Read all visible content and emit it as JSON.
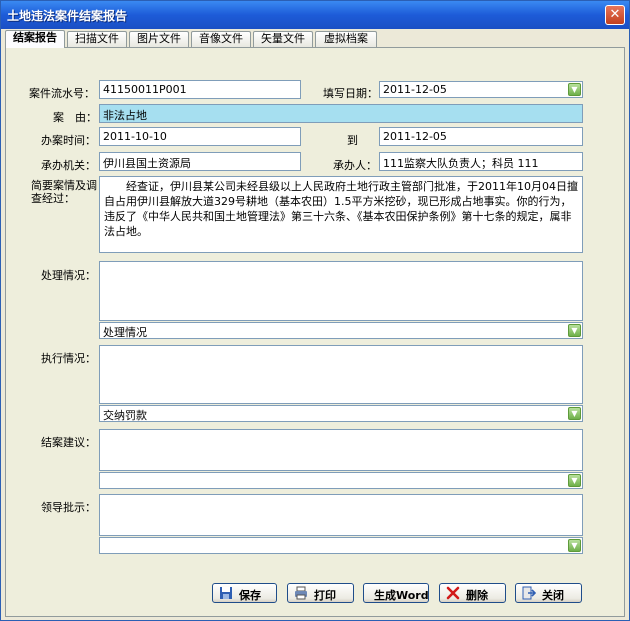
{
  "window": {
    "title": "土地违法案件结案报告",
    "close_symbol": "✕"
  },
  "tabs": [
    "结案报告",
    "扫描文件",
    "图片文件",
    "音像文件",
    "矢量文件",
    "虚拟档案"
  ],
  "form": {
    "case_no_label": "案件流水号：",
    "case_no": "41150011P001",
    "fill_date_label": "填写日期：",
    "fill_date": "2011-12-05",
    "cause_label": "案　由：",
    "cause": "非法占地",
    "handle_time_label": "办案时间：",
    "handle_start": "2011-10-10",
    "to_label": "到",
    "handle_end": "2011-12-05",
    "agency_label": "承办机关：",
    "agency": "伊川县国土资源局",
    "handler_label": "承办人：",
    "handler": "111监察大队负责人；科员 111",
    "summary_label": "简要案情及调查经过：",
    "summary": "　　经查证，伊川县某公司未经县级以上人民政府土地行政主管部门批准，于2011年10月04日擅自占用伊川县解放大道329号耕地（基本农田）1.5平方米挖砂，现已形成占地事实。你的行为，违反了《中华人民共和国土地管理法》第三十六条、《基本农田保护条例》第十七条的规定，属非法占地。",
    "processing_label": "处理情况：",
    "processing_text": "",
    "processing_select": "处理情况",
    "execution_label": "执行情况：",
    "execution_text": "",
    "execution_select": "交纳罚款",
    "closing_label": "结案建议：",
    "closing_text": "",
    "closing_select": "",
    "leader_label": "领导批示：",
    "leader_text": "",
    "leader_select": ""
  },
  "buttons": {
    "save": "保存",
    "print": "打印",
    "word": "生成Word",
    "delete": "删除",
    "close": "关闭"
  },
  "colors": {
    "title_bar": "#1d5bd8",
    "highlight_field": "#a6dff0",
    "dropdown_button": "#6fb04a"
  }
}
